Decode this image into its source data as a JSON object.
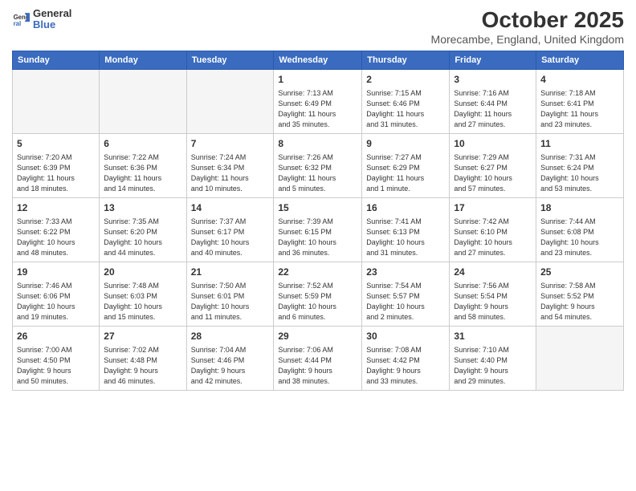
{
  "logo": {
    "general": "General",
    "blue": "Blue"
  },
  "title": "October 2025",
  "subtitle": "Morecambe, England, United Kingdom",
  "days_of_week": [
    "Sunday",
    "Monday",
    "Tuesday",
    "Wednesday",
    "Thursday",
    "Friday",
    "Saturday"
  ],
  "weeks": [
    [
      {
        "day": "",
        "info": ""
      },
      {
        "day": "",
        "info": ""
      },
      {
        "day": "",
        "info": ""
      },
      {
        "day": "1",
        "info": "Sunrise: 7:13 AM\nSunset: 6:49 PM\nDaylight: 11 hours\nand 35 minutes."
      },
      {
        "day": "2",
        "info": "Sunrise: 7:15 AM\nSunset: 6:46 PM\nDaylight: 11 hours\nand 31 minutes."
      },
      {
        "day": "3",
        "info": "Sunrise: 7:16 AM\nSunset: 6:44 PM\nDaylight: 11 hours\nand 27 minutes."
      },
      {
        "day": "4",
        "info": "Sunrise: 7:18 AM\nSunset: 6:41 PM\nDaylight: 11 hours\nand 23 minutes."
      }
    ],
    [
      {
        "day": "5",
        "info": "Sunrise: 7:20 AM\nSunset: 6:39 PM\nDaylight: 11 hours\nand 18 minutes."
      },
      {
        "day": "6",
        "info": "Sunrise: 7:22 AM\nSunset: 6:36 PM\nDaylight: 11 hours\nand 14 minutes."
      },
      {
        "day": "7",
        "info": "Sunrise: 7:24 AM\nSunset: 6:34 PM\nDaylight: 11 hours\nand 10 minutes."
      },
      {
        "day": "8",
        "info": "Sunrise: 7:26 AM\nSunset: 6:32 PM\nDaylight: 11 hours\nand 5 minutes."
      },
      {
        "day": "9",
        "info": "Sunrise: 7:27 AM\nSunset: 6:29 PM\nDaylight: 11 hours\nand 1 minute."
      },
      {
        "day": "10",
        "info": "Sunrise: 7:29 AM\nSunset: 6:27 PM\nDaylight: 10 hours\nand 57 minutes."
      },
      {
        "day": "11",
        "info": "Sunrise: 7:31 AM\nSunset: 6:24 PM\nDaylight: 10 hours\nand 53 minutes."
      }
    ],
    [
      {
        "day": "12",
        "info": "Sunrise: 7:33 AM\nSunset: 6:22 PM\nDaylight: 10 hours\nand 48 minutes."
      },
      {
        "day": "13",
        "info": "Sunrise: 7:35 AM\nSunset: 6:20 PM\nDaylight: 10 hours\nand 44 minutes."
      },
      {
        "day": "14",
        "info": "Sunrise: 7:37 AM\nSunset: 6:17 PM\nDaylight: 10 hours\nand 40 minutes."
      },
      {
        "day": "15",
        "info": "Sunrise: 7:39 AM\nSunset: 6:15 PM\nDaylight: 10 hours\nand 36 minutes."
      },
      {
        "day": "16",
        "info": "Sunrise: 7:41 AM\nSunset: 6:13 PM\nDaylight: 10 hours\nand 31 minutes."
      },
      {
        "day": "17",
        "info": "Sunrise: 7:42 AM\nSunset: 6:10 PM\nDaylight: 10 hours\nand 27 minutes."
      },
      {
        "day": "18",
        "info": "Sunrise: 7:44 AM\nSunset: 6:08 PM\nDaylight: 10 hours\nand 23 minutes."
      }
    ],
    [
      {
        "day": "19",
        "info": "Sunrise: 7:46 AM\nSunset: 6:06 PM\nDaylight: 10 hours\nand 19 minutes."
      },
      {
        "day": "20",
        "info": "Sunrise: 7:48 AM\nSunset: 6:03 PM\nDaylight: 10 hours\nand 15 minutes."
      },
      {
        "day": "21",
        "info": "Sunrise: 7:50 AM\nSunset: 6:01 PM\nDaylight: 10 hours\nand 11 minutes."
      },
      {
        "day": "22",
        "info": "Sunrise: 7:52 AM\nSunset: 5:59 PM\nDaylight: 10 hours\nand 6 minutes."
      },
      {
        "day": "23",
        "info": "Sunrise: 7:54 AM\nSunset: 5:57 PM\nDaylight: 10 hours\nand 2 minutes."
      },
      {
        "day": "24",
        "info": "Sunrise: 7:56 AM\nSunset: 5:54 PM\nDaylight: 9 hours\nand 58 minutes."
      },
      {
        "day": "25",
        "info": "Sunrise: 7:58 AM\nSunset: 5:52 PM\nDaylight: 9 hours\nand 54 minutes."
      }
    ],
    [
      {
        "day": "26",
        "info": "Sunrise: 7:00 AM\nSunset: 4:50 PM\nDaylight: 9 hours\nand 50 minutes."
      },
      {
        "day": "27",
        "info": "Sunrise: 7:02 AM\nSunset: 4:48 PM\nDaylight: 9 hours\nand 46 minutes."
      },
      {
        "day": "28",
        "info": "Sunrise: 7:04 AM\nSunset: 4:46 PM\nDaylight: 9 hours\nand 42 minutes."
      },
      {
        "day": "29",
        "info": "Sunrise: 7:06 AM\nSunset: 4:44 PM\nDaylight: 9 hours\nand 38 minutes."
      },
      {
        "day": "30",
        "info": "Sunrise: 7:08 AM\nSunset: 4:42 PM\nDaylight: 9 hours\nand 33 minutes."
      },
      {
        "day": "31",
        "info": "Sunrise: 7:10 AM\nSunset: 4:40 PM\nDaylight: 9 hours\nand 29 minutes."
      },
      {
        "day": "",
        "info": ""
      }
    ]
  ]
}
